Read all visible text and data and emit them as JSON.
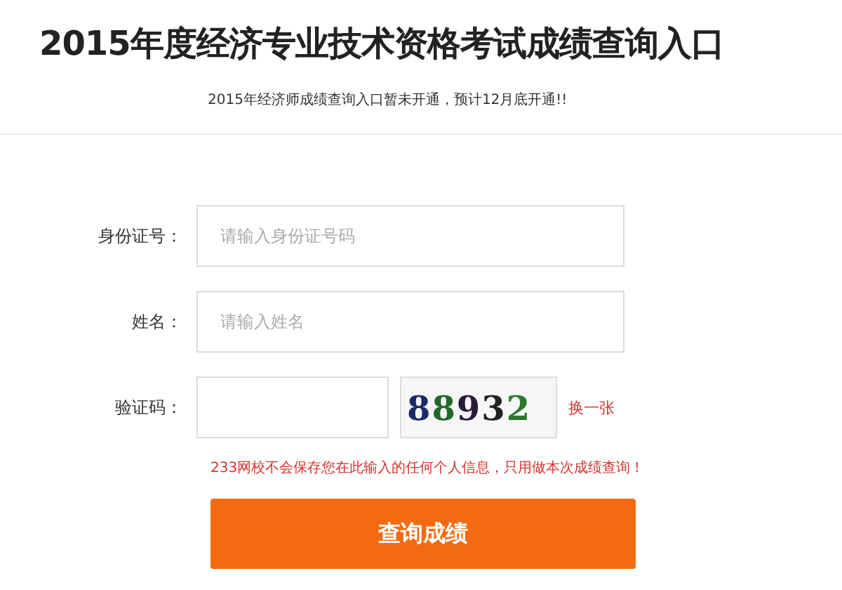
{
  "title": "2015年度经济专业技术资格考试成绩查询入口",
  "notice": "2015年经济师成绩查询入口暂未开通，预计12月底开通!!",
  "fields": [
    {
      "label": "身份证号：",
      "placeholder": "请输入身份证号码"
    },
    {
      "label": "姓名：",
      "placeholder": "请输入姓名"
    }
  ],
  "captcha": {
    "label": "验证码：",
    "code": "88932",
    "refresh": "换一张"
  },
  "privacy_note": "233网校不会保存您在此输入的任何个人信息，只用做本次成绩查询！",
  "submit": "查询成绩"
}
